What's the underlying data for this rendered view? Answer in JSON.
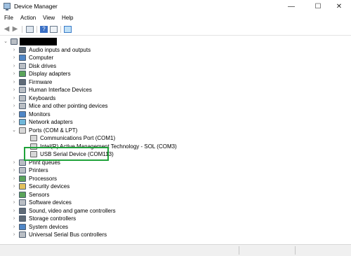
{
  "window": {
    "title": "Device Manager",
    "minimize": "—",
    "maximize": "☐",
    "close": "✕"
  },
  "menu": [
    "File",
    "Action",
    "View",
    "Help"
  ],
  "tree": {
    "categories": [
      {
        "label": "Audio inputs and outputs",
        "icon": "speaker-icon"
      },
      {
        "label": "Computer",
        "icon": "computer-icon"
      },
      {
        "label": "Disk drives",
        "icon": "disk-drive-icon"
      },
      {
        "label": "Display adapters",
        "icon": "display-adapter-icon"
      },
      {
        "label": "Firmware",
        "icon": "firmware-icon"
      },
      {
        "label": "Human Interface Devices",
        "icon": "hid-icon"
      },
      {
        "label": "Keyboards",
        "icon": "keyboard-icon"
      },
      {
        "label": "Mice and other pointing devices",
        "icon": "mouse-icon"
      },
      {
        "label": "Monitors",
        "icon": "monitor-icon"
      },
      {
        "label": "Network adapters",
        "icon": "network-adapter-icon"
      },
      {
        "label": "Ports (COM & LPT)",
        "icon": "port-icon",
        "expanded": true
      },
      {
        "label": "Print queues",
        "icon": "print-queue-icon"
      },
      {
        "label": "Printers",
        "icon": "printer-icon"
      },
      {
        "label": "Processors",
        "icon": "processor-icon"
      },
      {
        "label": "Security devices",
        "icon": "security-device-icon"
      },
      {
        "label": "Sensors",
        "icon": "sensor-icon"
      },
      {
        "label": "Software devices",
        "icon": "software-device-icon"
      },
      {
        "label": "Sound, video and game controllers",
        "icon": "sound-controller-icon"
      },
      {
        "label": "Storage controllers",
        "icon": "storage-controller-icon"
      },
      {
        "label": "System devices",
        "icon": "system-device-icon"
      },
      {
        "label": "Universal Serial Bus controllers",
        "icon": "usb-controller-icon"
      }
    ],
    "ports": [
      {
        "label": "Communications Port (COM1)",
        "icon": "port-icon"
      },
      {
        "label": "Intel(R) Active Management Technology - SOL (COM3)",
        "icon": "port-icon"
      },
      {
        "label": "USB Serial Device (COM113)",
        "icon": "port-icon",
        "highlighted": true
      }
    ]
  },
  "colors": {
    "highlight_border": "#1fa33a",
    "redaction": "#000000"
  }
}
